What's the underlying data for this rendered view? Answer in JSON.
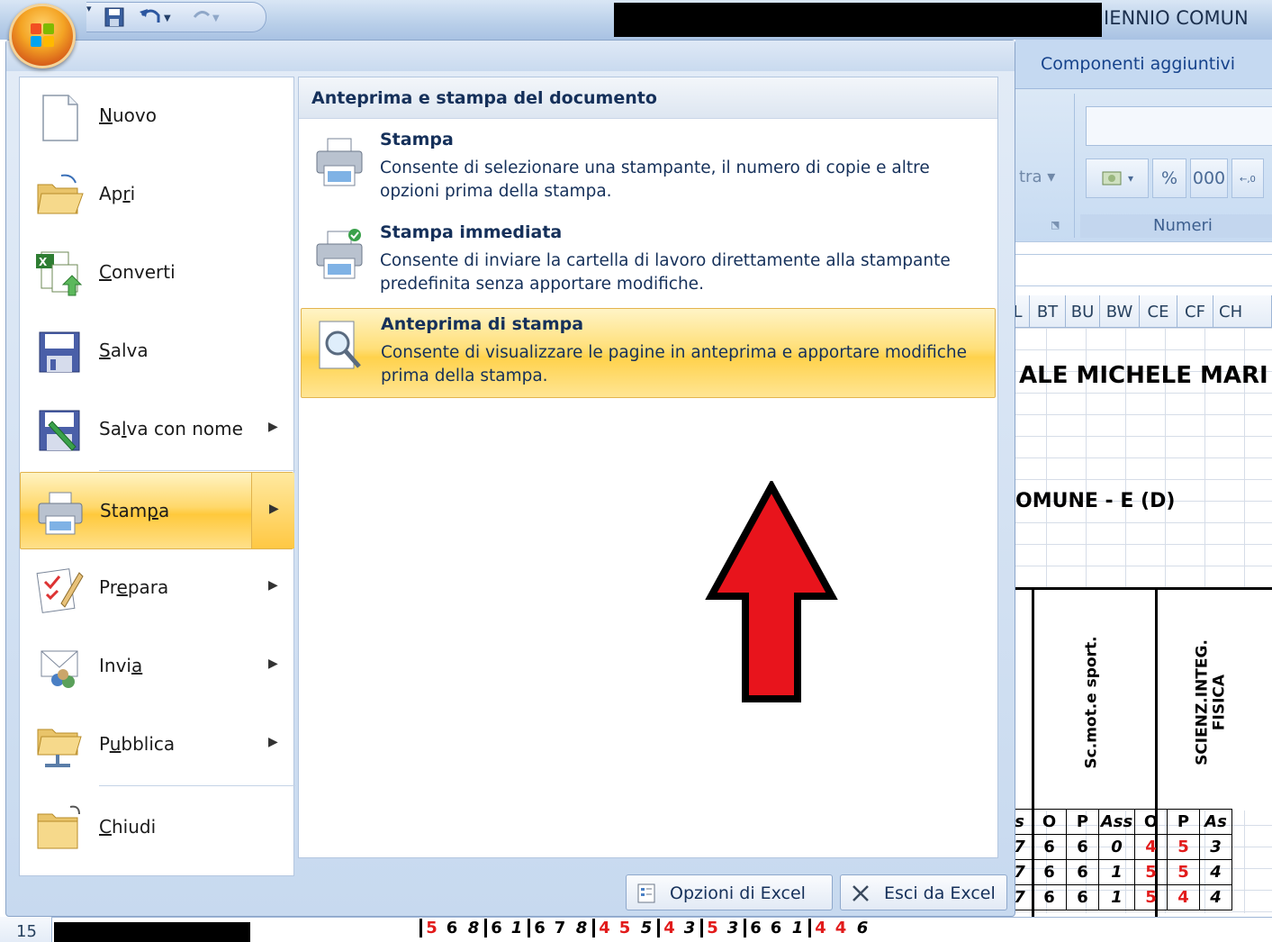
{
  "window": {
    "title_fragment": "IENNIO COMUN"
  },
  "ribbon": {
    "tab_addins": "Componenti aggiuntivi",
    "partial_text": "tra",
    "numbers_group_label": "Numeri",
    "numbers_buttons": [
      "%",
      "000"
    ]
  },
  "sheet": {
    "column_headers": [
      "L",
      "BT",
      "BU",
      "BW",
      "CE",
      "CF",
      "CH"
    ],
    "title_fragment": "ALE MICHELE MARI",
    "subtitle_fragment": "OMUNE - E (D)",
    "subjects": [
      "Sc.mot.e sport.",
      "SCIENZ.INTEG.\nFISICA"
    ],
    "grade_header": [
      "s",
      "O",
      "P",
      "Ass",
      "O",
      "P",
      "As"
    ],
    "row_15_label": "15"
  },
  "office_menu": {
    "left_items": [
      {
        "label": "Nuovo",
        "icon": "new-document-icon",
        "accesskey_index": 0,
        "has_submenu": false
      },
      {
        "label": "Apri",
        "icon": "open-folder-icon",
        "accesskey_index": 2,
        "has_submenu": false
      },
      {
        "label": "Converti",
        "icon": "convert-icon",
        "accesskey_index": 0,
        "has_submenu": false
      },
      {
        "label": "Salva",
        "icon": "save-icon",
        "accesskey_index": 0,
        "has_submenu": false
      },
      {
        "label": "Salva con nome",
        "icon": "save-as-icon",
        "accesskey_index": 2,
        "has_submenu": true
      },
      {
        "label": "Stampa",
        "icon": "printer-icon",
        "accesskey_index": 4,
        "has_submenu": true,
        "selected": true
      },
      {
        "label": "Prepara",
        "icon": "prepare-icon",
        "accesskey_index": 2,
        "has_submenu": true
      },
      {
        "label": "Invia",
        "icon": "send-icon",
        "accesskey_index": 4,
        "has_submenu": true
      },
      {
        "label": "Pubblica",
        "icon": "publish-icon",
        "accesskey_index": 1,
        "has_submenu": true
      },
      {
        "label": "Chiudi",
        "icon": "close-folder-icon",
        "accesskey_index": 0,
        "has_submenu": false
      }
    ],
    "submenu": {
      "title": "Anteprima e stampa del documento",
      "items": [
        {
          "title": "Stampa",
          "description": "Consente di selezionare una stampante, il numero di copie e altre opzioni prima della stampa.",
          "icon": "printer-icon"
        },
        {
          "title": "Stampa immediata",
          "description": "Consente di inviare la cartella di lavoro direttamente alla stampante predefinita senza apportare modifiche.",
          "icon": "quick-print-icon"
        },
        {
          "title": "Anteprima di stampa",
          "description": "Consente di visualizzare le pagine in anteprima e apportare modifiche prima della stampa.",
          "icon": "print-preview-icon",
          "highlighted": true
        }
      ]
    },
    "buttons": {
      "excel_options": "Opzioni di Excel",
      "exit_excel": "Esci da Excel"
    }
  },
  "colors": {
    "highlight": "#ffd24c",
    "annotation_arrow": "#e8141c",
    "grade_red": "#e21b1b"
  }
}
